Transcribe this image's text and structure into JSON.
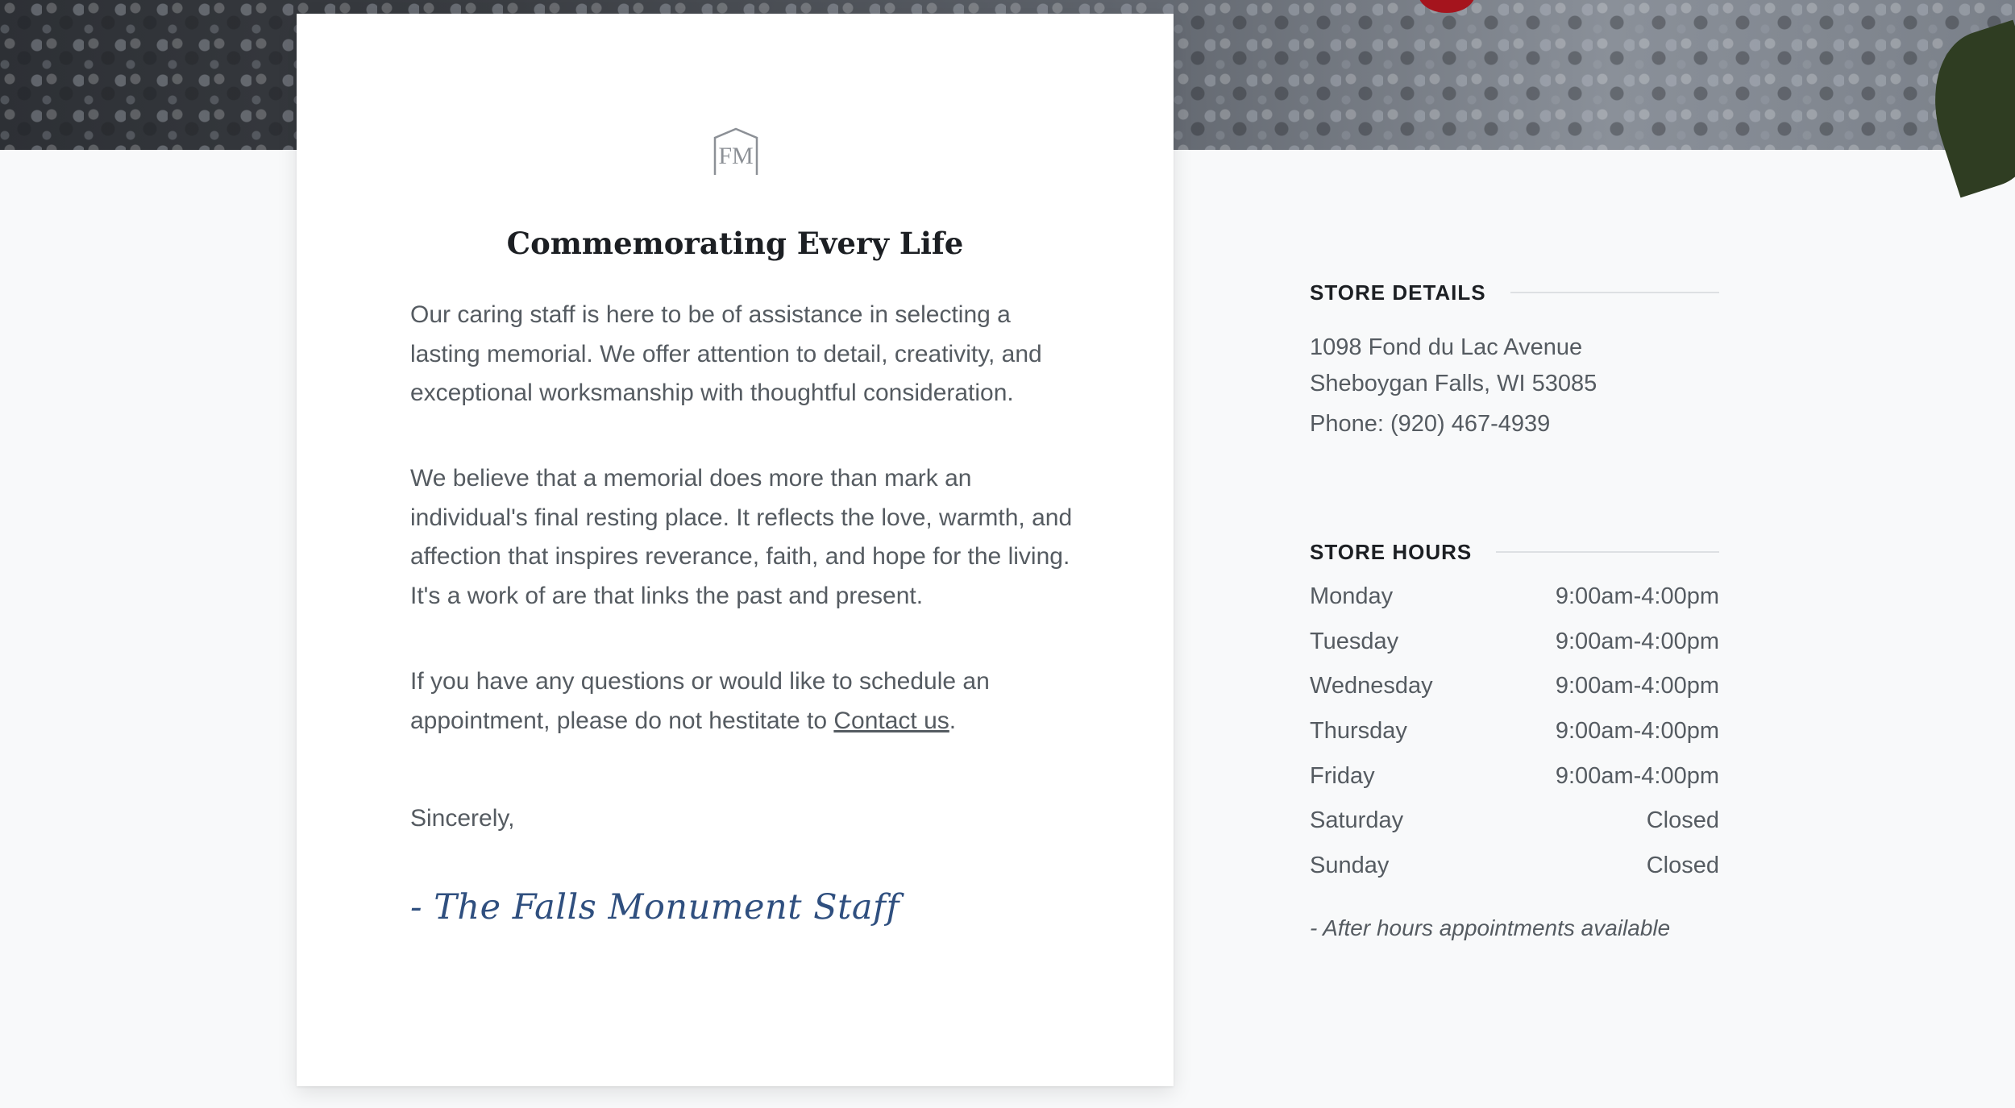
{
  "card": {
    "logo_text": "FM",
    "title": "Commemorating Every Life",
    "paragraphs": [
      "Our caring staff is here to be of assistance in selecting a lasting memorial. We offer attention to detail, creativity, and exceptional worksmanship with thoughtful consideration.",
      "We believe that a memorial does more than mark an individual's final resting place. It reflects the love, warmth, and affection that inspires reverance, faith, and hope for the living. It's a work of are that links the past and present."
    ],
    "contact_text_before": "If you have any questions or would like to schedule an appointment, please do not hestitate to ",
    "contact_link": "Contact us",
    "contact_text_after": ".",
    "closing": "Sincerely,",
    "signature": "- The Falls Monument Staff"
  },
  "details": {
    "heading": "STORE DETAILS",
    "address_line1": "1098 Fond du Lac Avenue",
    "address_line2": "Sheboygan Falls, WI 53085",
    "phone": "Phone: (920) 467-4939"
  },
  "hours": {
    "heading": "STORE HOURS",
    "rows": [
      {
        "day": "Monday",
        "time": "9:00am-4:00pm"
      },
      {
        "day": "Tuesday",
        "time": "9:00am-4:00pm"
      },
      {
        "day": "Wednesday",
        "time": "9:00am-4:00pm"
      },
      {
        "day": "Thursday",
        "time": "9:00am-4:00pm"
      },
      {
        "day": "Friday",
        "time": "9:00am-4:00pm"
      },
      {
        "day": "Saturday",
        "time": "Closed"
      },
      {
        "day": "Sunday",
        "time": "Closed"
      }
    ],
    "note": "- After hours appointments available"
  },
  "colors": {
    "background": "#f8f9fa",
    "card": "#ffffff",
    "heading": "#1c1f23",
    "body_text": "#555b61",
    "signature": "#2f4f7f",
    "rule": "#dde0e3"
  }
}
